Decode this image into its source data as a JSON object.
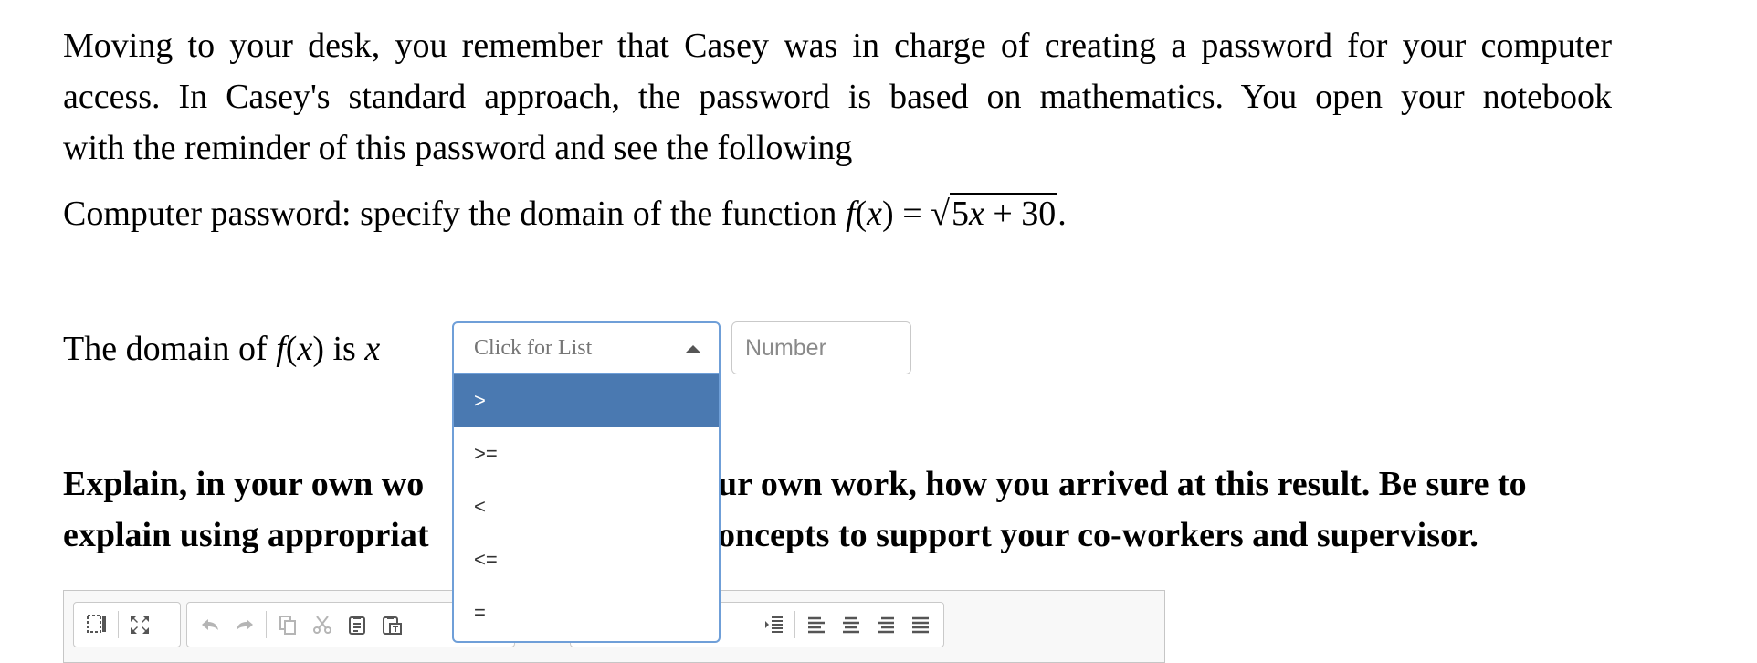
{
  "intro": {
    "line1": "Moving to your desk, you remember that Casey was in charge of creating a password for your computer",
    "line2": "access. In Casey's standard approach, the password is based on mathematics. You open your notebook",
    "line3": "with the reminder of this password and see the following"
  },
  "password_prompt": {
    "text": "Computer password: specify the domain of the function",
    "func_name": "f",
    "var": "x",
    "radicand_a": "5",
    "radicand_plus": " + ",
    "radicand_b": "30",
    "end": "."
  },
  "domain_question": {
    "prefix": "The domain of",
    "func_name": "f",
    "var": "x",
    "is": "is",
    "var2": "x"
  },
  "select": {
    "placeholder": "Click for List",
    "options": [
      ">",
      ">=",
      "<",
      "<=",
      "="
    ],
    "highlighted_index": 0
  },
  "number_input": {
    "placeholder": "Number",
    "value": ""
  },
  "explain": {
    "line1_left": "Explain, in your own wo",
    "line1_right": "ur own work, how you arrived at this result. Be sure to",
    "line2_left": "explain using appropriat",
    "line2_right": "oncepts to support your co-workers and supervisor."
  },
  "toolbar": {
    "icons": [
      "show-blocks-icon",
      "maximize-icon",
      "undo-icon",
      "redo-icon",
      "copy-icon",
      "cut-icon",
      "paste-icon",
      "paste-text-icon",
      "indent-icon",
      "align-left-icon",
      "align-center-icon",
      "align-right-icon",
      "justify-icon"
    ]
  }
}
